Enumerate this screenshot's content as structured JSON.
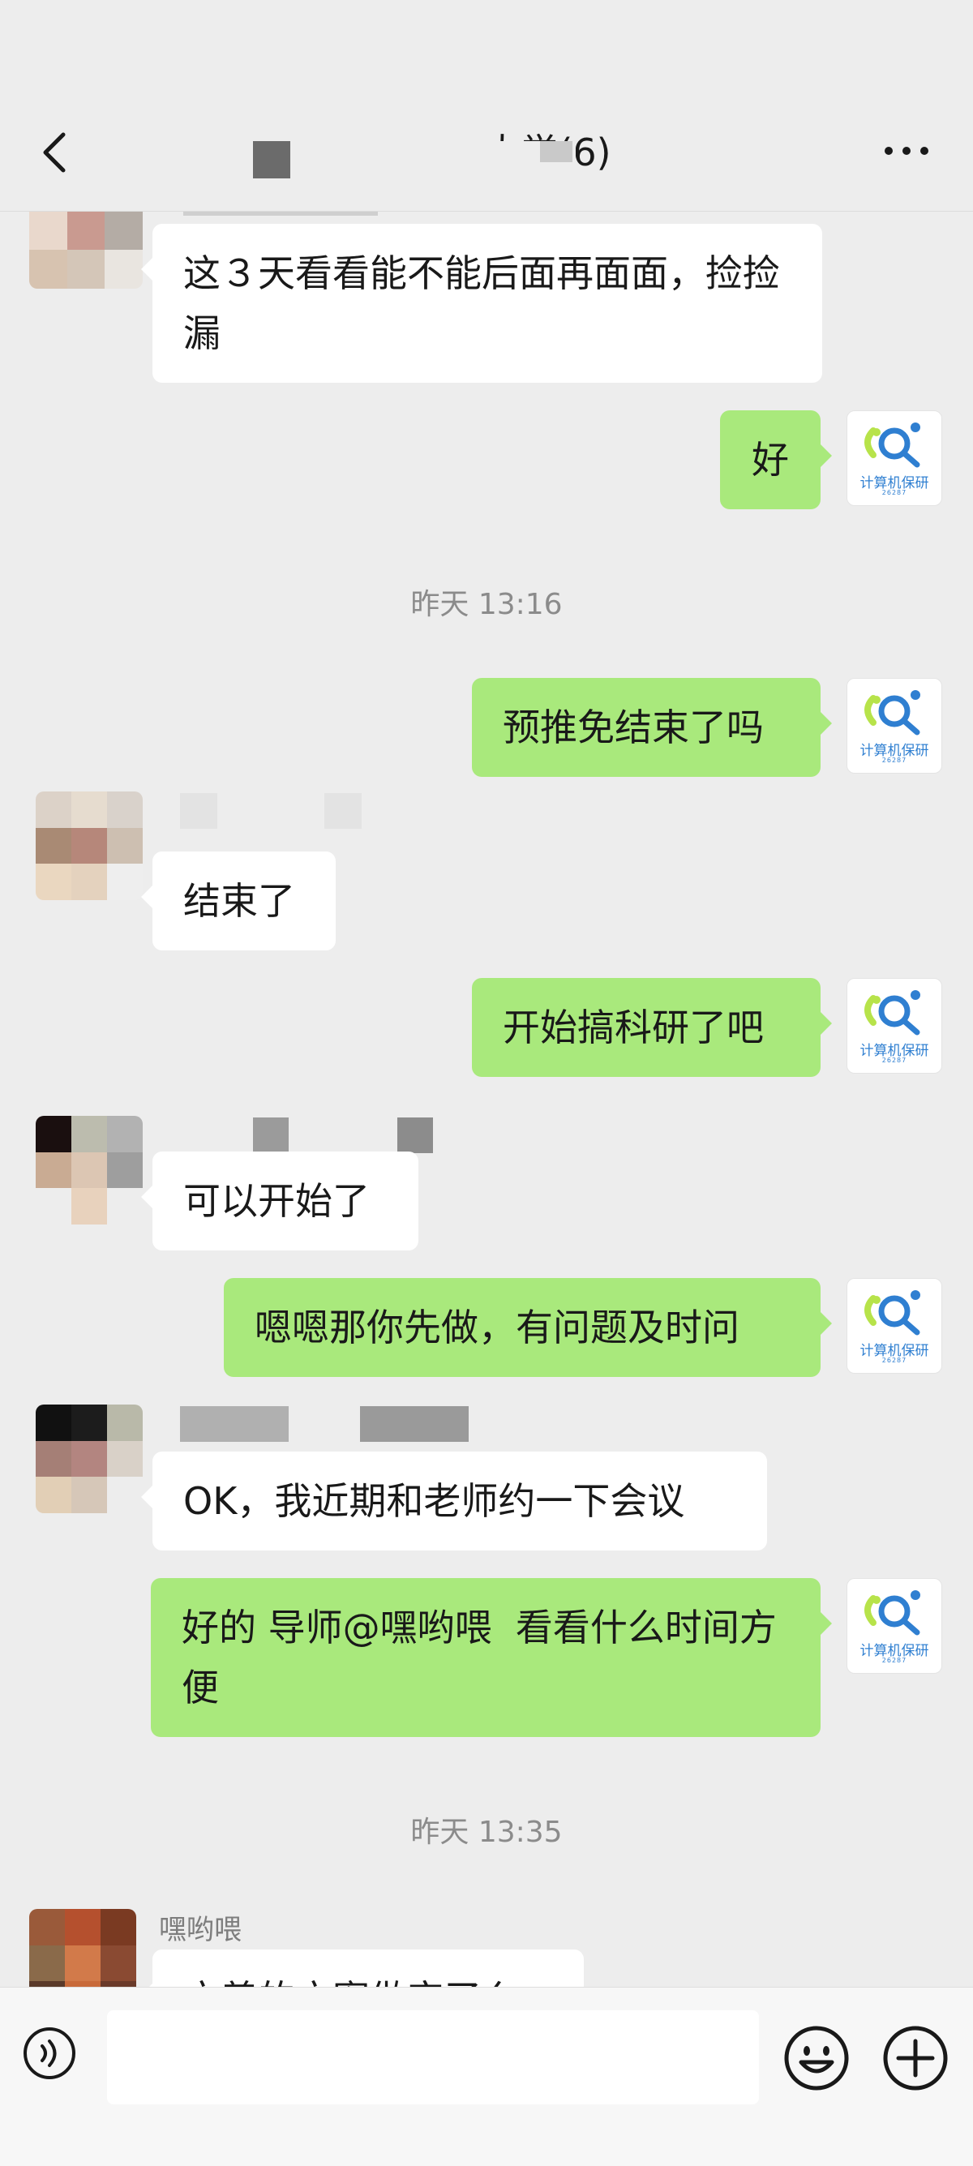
{
  "header": {
    "title": "大学(6)"
  },
  "messages": [
    {
      "text": "这３天看看能不能后面再面面，捡捡漏"
    },
    {
      "text": "好"
    },
    {
      "text": "预推免结束了吗"
    },
    {
      "text": "结束了"
    },
    {
      "text": "开始搞科研了吧"
    },
    {
      "text": "可以开始了"
    },
    {
      "text": "嗯嗯那你先做，有问题及时问"
    },
    {
      "text": "OK，我近期和老师约一下会议"
    },
    {
      "text": "好的 导师@嘿哟喂  看看什么时间方便"
    },
    {
      "text": "方善的方案做完了么"
    }
  ],
  "timestamps": [
    "昨天 13:16",
    "昨天 13:35"
  ],
  "senders": {
    "last": "嘿哟喂"
  },
  "self_avatar": {
    "label": "计算机保研",
    "sub": "26287"
  },
  "input": {
    "value": ""
  },
  "colors": {
    "background": "#ededed",
    "self_bubble": "#a9e97c",
    "other_bubble": "#ffffff",
    "logo_green": "#b7e34a",
    "logo_blue": "#2f7fd1"
  },
  "icons": [
    "back-icon",
    "more-icon",
    "voice-icon",
    "emoji-icon",
    "plus-icon"
  ]
}
